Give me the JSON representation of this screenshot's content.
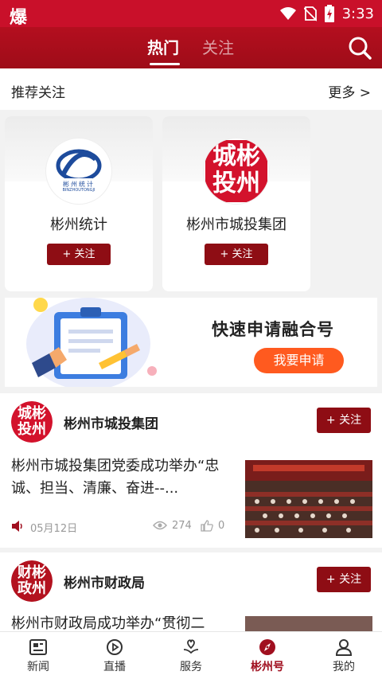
{
  "status_bar": {
    "app_glyph": "爆",
    "time": "3:33"
  },
  "header": {
    "tabs": [
      "热门",
      "关注"
    ],
    "active_tab": "热门"
  },
  "recommend": {
    "title": "推荐关注",
    "more": "更多 >",
    "cards": [
      {
        "name": "彬州统计",
        "logo_text": "彬州统计",
        "logo_sub": "BINZHOUTONGJI",
        "button": "+ 关注"
      },
      {
        "name": "彬州市城投集团",
        "logo_text": "城彬投州",
        "button": "+ 关注"
      }
    ]
  },
  "banner": {
    "headline": "快速申请融合号",
    "button": "我要申请"
  },
  "feed": [
    {
      "source": "彬州市城投集团",
      "avatar_text": "城彬投州",
      "follow": "+ 关注",
      "title": "彬州市城投集团党委成功举办“忠诚、担当、清廉、奋进--...",
      "date": "05月12日",
      "views": "274",
      "likes": "0"
    },
    {
      "source": "彬州市财政局",
      "avatar_text": "财彬政州",
      "follow": "+ 关注",
      "title": "彬州市财政局成功举办“贯彻二"
    }
  ],
  "bottom_nav": [
    {
      "label": "新闻",
      "icon": "news-icon"
    },
    {
      "label": "直播",
      "icon": "play-icon"
    },
    {
      "label": "服务",
      "icon": "service-icon"
    },
    {
      "label": "彬州号",
      "icon": "compass-icon",
      "active": true
    },
    {
      "label": "我的",
      "icon": "user-icon"
    }
  ],
  "colors": {
    "brand_red": "#9e0c18",
    "status_red": "#c9102a",
    "orange": "#ff5a1f"
  }
}
